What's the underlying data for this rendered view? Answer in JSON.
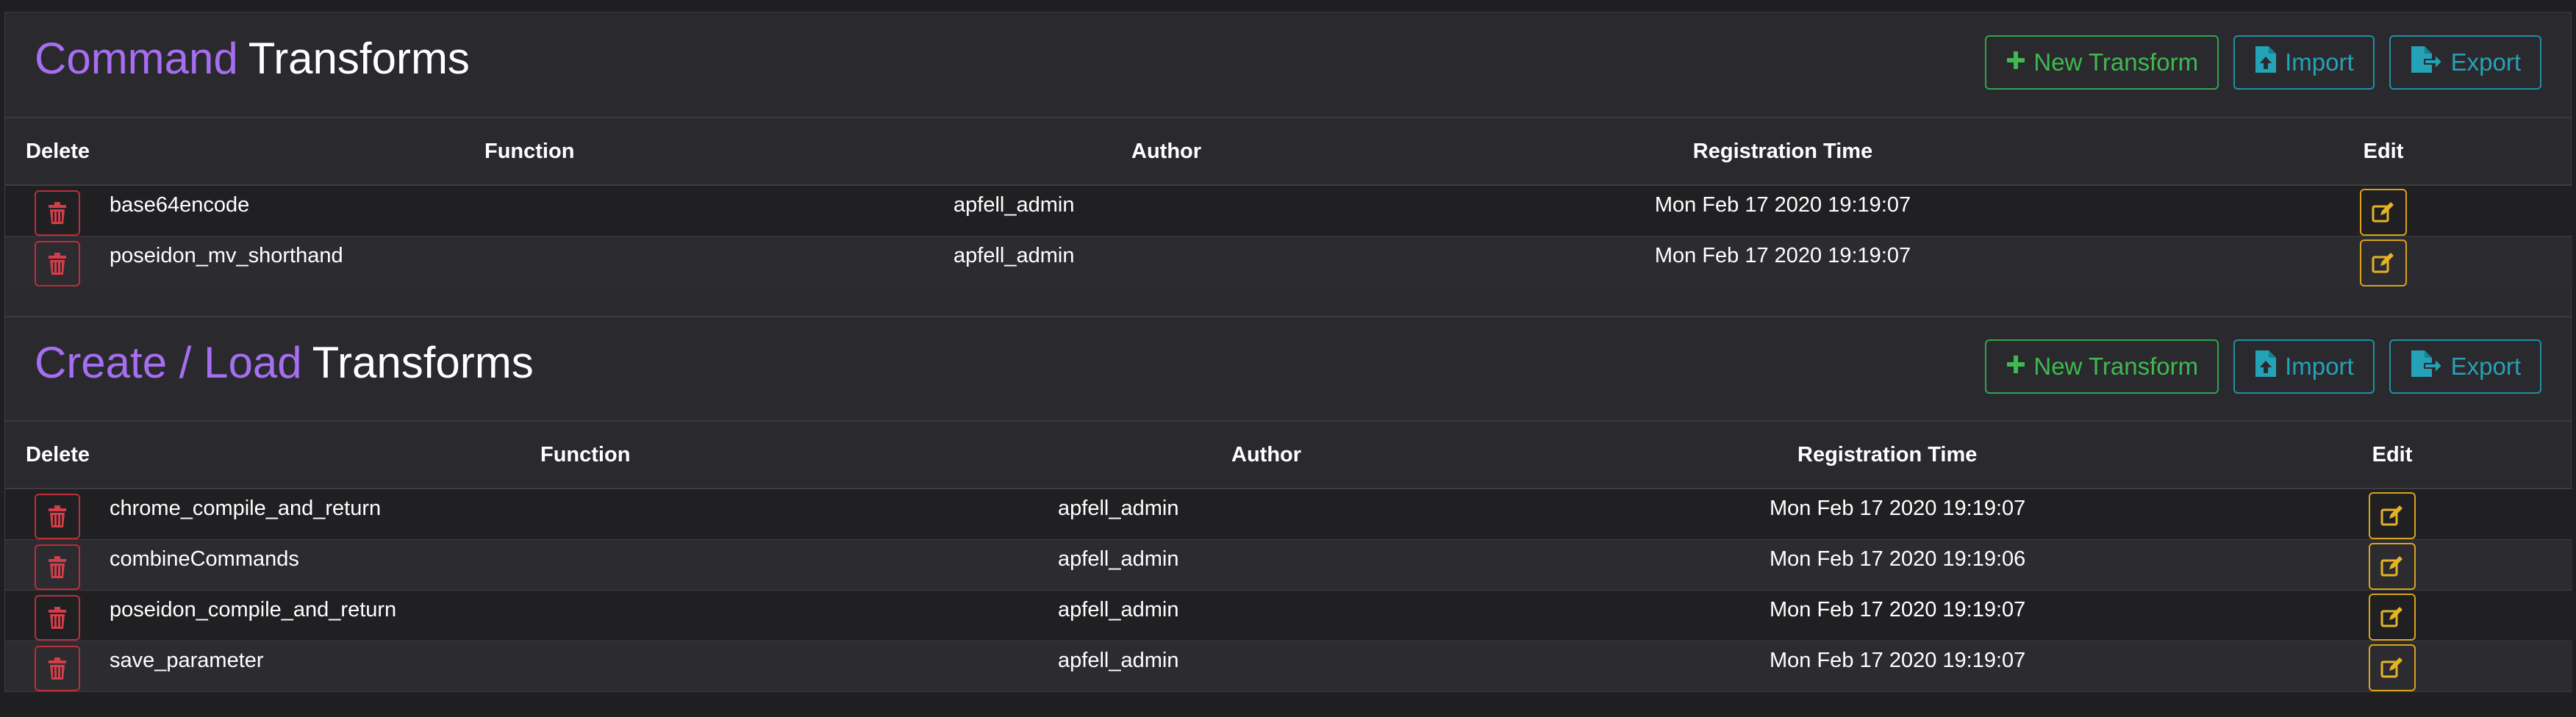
{
  "colors": {
    "accent_purple": "#a66ef1",
    "button_green": "#3fb950",
    "button_cyan": "#24a2b8",
    "delete_red": "#d23f4a",
    "edit_yellow": "#e6b325",
    "panel_bg": "#2a2a2e",
    "page_bg": "#1f1f22"
  },
  "icons": {
    "delete": "trash-icon",
    "edit": "edit-icon",
    "new": "plus-icon",
    "import": "file-upload-icon",
    "export": "file-export-icon"
  },
  "command_transforms": {
    "title_accent": "Command",
    "title_main": "Transforms",
    "buttons": {
      "new": "New Transform",
      "import": "Import",
      "export": "Export"
    },
    "columns": [
      "Delete",
      "Function",
      "Author",
      "Registration Time",
      "Edit"
    ],
    "rows": [
      {
        "function": "base64encode",
        "author": "apfell_admin",
        "time": "Mon Feb 17 2020 19:19:07"
      },
      {
        "function": "poseidon_mv_shorthand",
        "author": "apfell_admin",
        "time": "Mon Feb 17 2020 19:19:07"
      }
    ]
  },
  "create_load_transforms": {
    "title_accent": "Create / Load",
    "title_main": "Transforms",
    "buttons": {
      "new": "New Transform",
      "import": "Import",
      "export": "Export"
    },
    "columns": [
      "Delete",
      "Function",
      "Author",
      "Registration Time",
      "Edit"
    ],
    "rows": [
      {
        "function": "chrome_compile_and_return",
        "author": "apfell_admin",
        "time": "Mon Feb 17 2020 19:19:07"
      },
      {
        "function": "combineCommands",
        "author": "apfell_admin",
        "time": "Mon Feb 17 2020 19:19:06"
      },
      {
        "function": "poseidon_compile_and_return",
        "author": "apfell_admin",
        "time": "Mon Feb 17 2020 19:19:07"
      },
      {
        "function": "save_parameter",
        "author": "apfell_admin",
        "time": "Mon Feb 17 2020 19:19:07"
      }
    ]
  }
}
